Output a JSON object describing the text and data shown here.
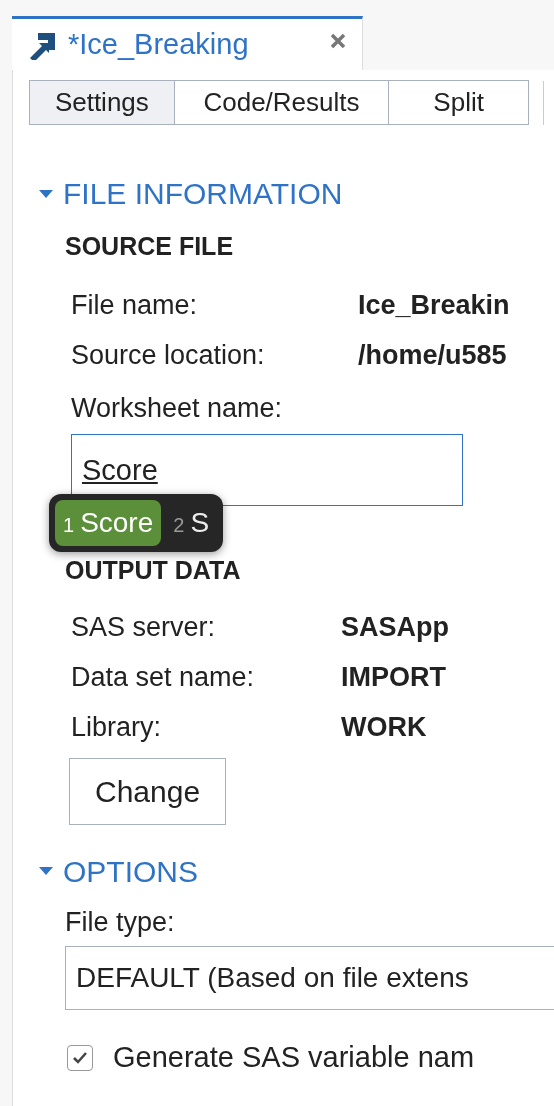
{
  "tab": {
    "title": "*Ice_Breaking"
  },
  "view_modes": [
    {
      "label": "Settings",
      "selected": true
    },
    {
      "label": "Code/Results",
      "selected": false
    },
    {
      "label": "Split",
      "selected": false
    }
  ],
  "file_information": {
    "title": "FILE INFORMATION",
    "expanded": true,
    "source_file": {
      "heading": "SOURCE FILE",
      "fields": [
        {
          "label": "File name:",
          "value": "Ice_Breakin"
        },
        {
          "label": "Source location:",
          "value": "/home/u585"
        }
      ]
    },
    "worksheet": {
      "label": "Worksheet name:",
      "value": "Score"
    },
    "ime_candidates": [
      {
        "number": "1",
        "text": "Score",
        "selected": true
      },
      {
        "number": "2",
        "text": "S",
        "selected": false
      }
    ],
    "output_data": {
      "heading": "OUTPUT DATA",
      "fields": [
        {
          "label": "SAS server:",
          "value": "SASApp"
        },
        {
          "label": "Data set name:",
          "value": "IMPORT"
        },
        {
          "label": "Library:",
          "value": "WORK"
        }
      ],
      "change_button": "Change"
    }
  },
  "options": {
    "title": "OPTIONS",
    "expanded": true,
    "file_type": {
      "label": "File type:",
      "value": "DEFAULT (Based on file extens"
    },
    "checkboxes": [
      {
        "label": "Generate SAS variable nam",
        "checked": true
      }
    ]
  }
}
